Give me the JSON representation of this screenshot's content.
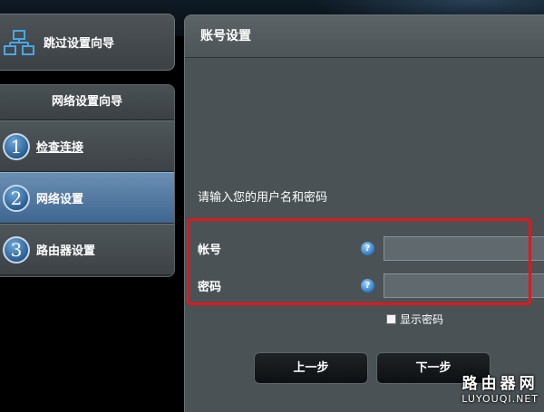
{
  "sidebar": {
    "skip_label": "跳过设置向导",
    "wizard_title": "网络设置向导",
    "steps": [
      {
        "number": "1",
        "label": "检查连接"
      },
      {
        "number": "2",
        "label": "网络设置"
      },
      {
        "number": "3",
        "label": "路由器设置"
      }
    ]
  },
  "main": {
    "header": "账号设置",
    "instruction": "请输入您的用户名和密码",
    "account_label": "帐号",
    "password_label": "密码",
    "account_value": "",
    "password_value": "",
    "help_glyph": "?",
    "show_password_label": "显示密码",
    "prev_button": "上一步",
    "next_button": "下一步"
  },
  "watermark": {
    "cn": "路由器网",
    "en": "LUYOUQI.NET"
  },
  "colors": {
    "highlight": "#e0181c",
    "active_step": "#3e6690"
  }
}
